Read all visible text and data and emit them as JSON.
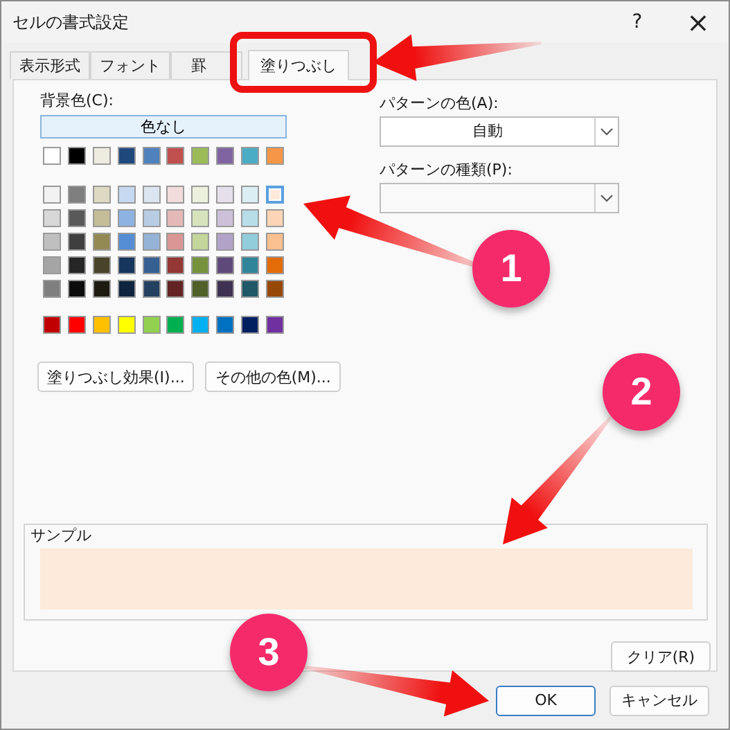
{
  "window": {
    "title": "セルの書式設定",
    "help": "?",
    "close": "×"
  },
  "tabs": [
    {
      "label": "表示形式",
      "selected": false
    },
    {
      "label": "フォント",
      "selected": false
    },
    {
      "label": "罫",
      "selected": false
    },
    {
      "label": "塗りつぶし",
      "selected": true
    }
  ],
  "background": {
    "label": "背景色(C):",
    "no_color": "色なし",
    "theme_row": [
      {
        "color": "#ffffff",
        "selected": false
      },
      {
        "color": "#000000",
        "selected": false
      },
      {
        "color": "#eeece1",
        "selected": false
      },
      {
        "color": "#1f497d",
        "selected": false
      },
      {
        "color": "#4f81bd",
        "selected": false
      },
      {
        "color": "#c0504d",
        "selected": false
      },
      {
        "color": "#9bbb59",
        "selected": false
      },
      {
        "color": "#8064a2",
        "selected": false
      },
      {
        "color": "#4bacc6",
        "selected": false
      },
      {
        "color": "#f79646",
        "selected": false
      }
    ],
    "tint_rows": [
      [
        {
          "color": "#f2f2f2",
          "selected": false
        },
        {
          "color": "#7f7f7f",
          "selected": false
        },
        {
          "color": "#ddd9c3",
          "selected": false
        },
        {
          "color": "#c6d9f0",
          "selected": false
        },
        {
          "color": "#dbe5f1",
          "selected": false
        },
        {
          "color": "#f2dcdb",
          "selected": false
        },
        {
          "color": "#ebf1dd",
          "selected": false
        },
        {
          "color": "#e5e0ec",
          "selected": false
        },
        {
          "color": "#dbeef3",
          "selected": false
        },
        {
          "color": "#fdeada",
          "selected": true
        }
      ],
      [
        {
          "color": "#d8d8d8",
          "selected": false
        },
        {
          "color": "#595959",
          "selected": false
        },
        {
          "color": "#c4bd97",
          "selected": false
        },
        {
          "color": "#8db3e2",
          "selected": false
        },
        {
          "color": "#b8cce4",
          "selected": false
        },
        {
          "color": "#e5b9b7",
          "selected": false
        },
        {
          "color": "#d7e3bc",
          "selected": false
        },
        {
          "color": "#ccc1d9",
          "selected": false
        },
        {
          "color": "#b7dde8",
          "selected": false
        },
        {
          "color": "#fbd5b5",
          "selected": false
        }
      ],
      [
        {
          "color": "#bfbfbf",
          "selected": false
        },
        {
          "color": "#3f3f3f",
          "selected": false
        },
        {
          "color": "#938953",
          "selected": false
        },
        {
          "color": "#548dd4",
          "selected": false
        },
        {
          "color": "#95b3d7",
          "selected": false
        },
        {
          "color": "#d99694",
          "selected": false
        },
        {
          "color": "#c3d69b",
          "selected": false
        },
        {
          "color": "#b2a2c7",
          "selected": false
        },
        {
          "color": "#92cddc",
          "selected": false
        },
        {
          "color": "#fac08f",
          "selected": false
        }
      ],
      [
        {
          "color": "#a5a5a5",
          "selected": false
        },
        {
          "color": "#262626",
          "selected": false
        },
        {
          "color": "#494429",
          "selected": false
        },
        {
          "color": "#17365d",
          "selected": false
        },
        {
          "color": "#366092",
          "selected": false
        },
        {
          "color": "#953734",
          "selected": false
        },
        {
          "color": "#76923c",
          "selected": false
        },
        {
          "color": "#5f497a",
          "selected": false
        },
        {
          "color": "#31859b",
          "selected": false
        },
        {
          "color": "#e36c09",
          "selected": false
        }
      ],
      [
        {
          "color": "#7f7f7f",
          "selected": false
        },
        {
          "color": "#0c0c0c",
          "selected": false
        },
        {
          "color": "#1d1b10",
          "selected": false
        },
        {
          "color": "#0f243e",
          "selected": false
        },
        {
          "color": "#244061",
          "selected": false
        },
        {
          "color": "#632423",
          "selected": false
        },
        {
          "color": "#4f6128",
          "selected": false
        },
        {
          "color": "#3f3151",
          "selected": false
        },
        {
          "color": "#205867",
          "selected": false
        },
        {
          "color": "#974806",
          "selected": false
        }
      ]
    ],
    "standard_row": [
      {
        "color": "#c00000",
        "selected": false
      },
      {
        "color": "#ff0000",
        "selected": false
      },
      {
        "color": "#ffc000",
        "selected": false
      },
      {
        "color": "#ffff00",
        "selected": false
      },
      {
        "color": "#92d050",
        "selected": false
      },
      {
        "color": "#00b050",
        "selected": false
      },
      {
        "color": "#00b0f0",
        "selected": false
      },
      {
        "color": "#0070c0",
        "selected": false
      },
      {
        "color": "#002060",
        "selected": false
      },
      {
        "color": "#7030a0",
        "selected": false
      }
    ],
    "buttons": [
      "塗りつぶし効果(I)...",
      "その他の色(M)..."
    ]
  },
  "pattern_color": {
    "label": "パターンの色(A):",
    "value": "自動"
  },
  "pattern_style": {
    "label": "パターンの種類(P):"
  },
  "sample": {
    "label": "サンプル",
    "color": "#fdeada"
  },
  "clear_button": "クリア(R)",
  "footer_buttons": [
    {
      "label": "OK",
      "default": true
    },
    {
      "label": "キャンセル",
      "default": false
    }
  ],
  "annotations": [
    "1",
    "2",
    "3"
  ]
}
